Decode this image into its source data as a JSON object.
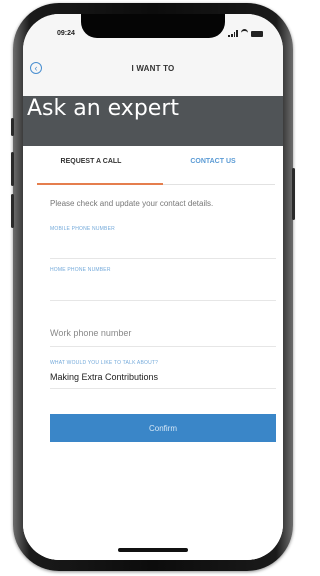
{
  "status_bar": {
    "time": "09:24"
  },
  "header": {
    "title": "I WANT TO",
    "back_icon": "chevron-left-circle-icon"
  },
  "banner": {
    "title": "Ask an expert"
  },
  "tabs": [
    {
      "label": "REQUEST A CALL",
      "active": true
    },
    {
      "label": "CONTACT US",
      "active": false
    }
  ],
  "form": {
    "intro": "Please check and update your contact details.",
    "mobile_label": "MOBILE PHONE NUMBER",
    "home_label": "HOME PHONE NUMBER",
    "work_placeholder": "Work phone number",
    "topic_label": "WHAT WOULD YOU LIKE TO TALK ABOUT?",
    "topic_value": "Making Extra Contributions",
    "confirm_label": "Confirm"
  },
  "colors": {
    "accent_blue": "#3a86c8",
    "tab_underline": "#e57e4d",
    "banner": "#505457"
  }
}
